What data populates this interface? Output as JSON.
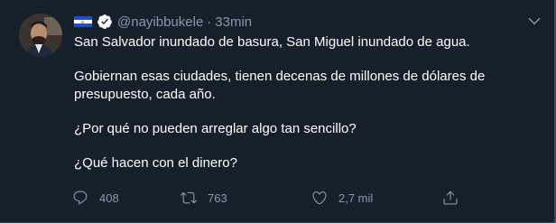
{
  "tweet": {
    "handle": "@nayibbukele",
    "separator": "·",
    "time": "33min",
    "paragraphs": [
      "San Salvador inundado de basura, San Miguel inundado de agua.",
      "Gobiernan esas ciudades, tienen decenas de millones de dólares de presupuesto, cada año.",
      "¿Por qué no pueden arreglar algo tan sencillo?",
      "¿Qué hacen con el dinero?"
    ],
    "replies": "408",
    "retweets": "763",
    "likes": "2,7 mil"
  },
  "icons": {
    "flag": "el-salvador-flag-icon",
    "verified": "verified-badge-icon",
    "menu": "chevron-down-icon",
    "reply": "reply-icon",
    "retweet": "retweet-icon",
    "like": "heart-icon",
    "share": "share-icon"
  },
  "colors": {
    "background": "#15202b",
    "text": "#ffffff",
    "muted": "#8899a6",
    "verified": "#ffffff"
  }
}
